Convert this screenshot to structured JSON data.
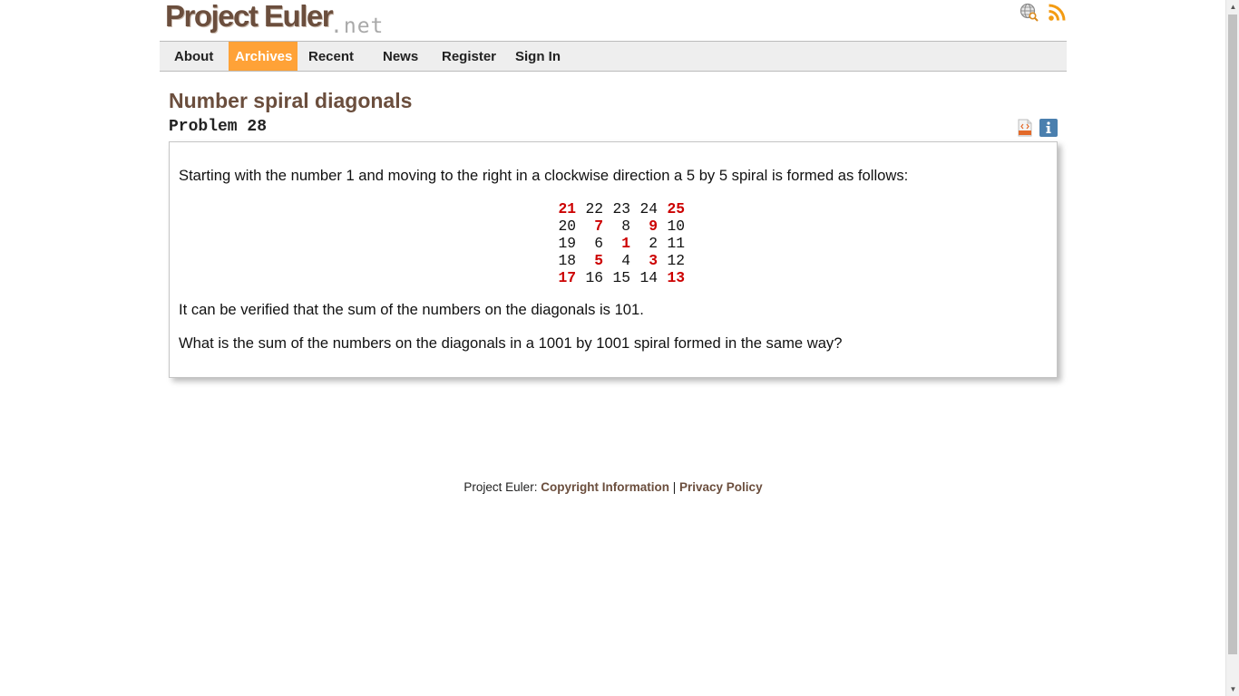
{
  "header": {
    "logo_main": "Project Euler",
    "logo_net": ".net",
    "icons": [
      "globe-search-icon",
      "rss-icon"
    ]
  },
  "nav": {
    "items": [
      {
        "label": "About",
        "active": false
      },
      {
        "label": "Archives",
        "active": true
      },
      {
        "label": "Recent",
        "active": false
      },
      {
        "label": "News",
        "active": false
      },
      {
        "label": "Register",
        "active": false
      },
      {
        "label": "Sign In",
        "active": false
      }
    ]
  },
  "problem": {
    "title": "Number spiral diagonals",
    "number_label": "Problem 28",
    "tools": [
      "html-icon",
      "info-icon"
    ],
    "intro": "Starting with the number 1 and moving to the right in a clockwise direction a 5 by 5 spiral is formed as follows:",
    "spiral": [
      [
        "21",
        "22",
        "23",
        "24",
        "25"
      ],
      [
        "20",
        "7",
        "8",
        "9",
        "10"
      ],
      [
        "19",
        "6",
        "1",
        "2",
        "11"
      ],
      [
        "18",
        "5",
        "4",
        "3",
        "12"
      ],
      [
        "17",
        "16",
        "15",
        "14",
        "13"
      ]
    ],
    "verify": "It can be verified that the sum of the numbers on the diagonals is 101.",
    "question": "What is the sum of the numbers on the diagonals in a 1001 by 1001 spiral formed in the same way?"
  },
  "footer": {
    "prefix": "Project Euler:",
    "copyright_link": "Copyright Information",
    "separator": "|",
    "privacy_link": "Privacy Policy"
  },
  "colors": {
    "brand_brown": "#6b4e3d",
    "nav_active": "#ffa237",
    "diagonal_red": "#cc0000",
    "info_blue": "#4a7fae"
  }
}
